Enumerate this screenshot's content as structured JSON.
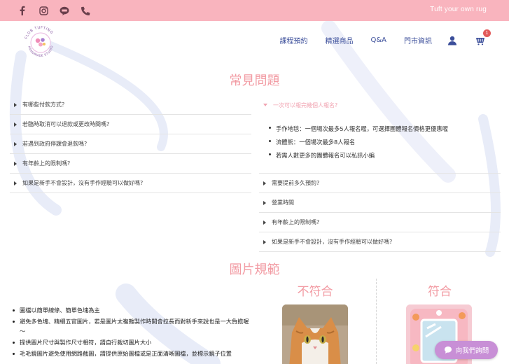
{
  "topbar": {
    "tagline": "Tuft your own rug",
    "social_icons": [
      "facebook-icon",
      "instagram-icon",
      "line-icon",
      "phone-icon"
    ]
  },
  "logo": {
    "text_top": "FLOB TUFTING",
    "text_bottom": "HANDMADE STUDIO"
  },
  "nav": {
    "items": [
      "課程預約",
      "精選商品",
      "Q&A",
      "門市資訊"
    ],
    "cart_count": "1"
  },
  "faq": {
    "title": "常見問題",
    "left_items": [
      "有哪些付款方式？",
      "若臨時取消可以退款或更改時間嗎?",
      "若遇到政府停課會退款嗎?",
      "有年齡上的限制嗎?",
      "如果是新手不會設計，沒有手作經驗可以做好嗎?"
    ],
    "right_open": {
      "question": "一次可以報完幾個人報名?",
      "answers": [
        "手作地毯：一個場次最多5人報名喔，可選擇團體報名價格更優惠喔",
        "流體熊：一個場次最多8人報名",
        "若需人數更多的團體報名可以私訊小編"
      ]
    },
    "right_items": [
      "需要提前多久預約?",
      "營業時間",
      "有年齡上的限制嗎?",
      "如果是新手不會設計，沒有手作經驗可以做好嗎?"
    ]
  },
  "image_spec": {
    "title": "圖片規範",
    "rules": [
      "圖檔以簡單線條、簡單色塊為主",
      "避免多色塊、精細五官圖片，若是圖片太複雜製作時間會拉長而對新手來說也是一大負擔喔～",
      "提供圖片尺寸與製作尺寸相符，請自行裁切圖片大小",
      "毛毛鏡圖片避免使用網路截圖，請提供原始圖檔或是正面清晰圖檔，並標示鏡子位置"
    ],
    "bad_label": "不符合",
    "good_label": "符合"
  },
  "chat": {
    "label": "向我們詢問"
  },
  "colors": {
    "topbar": "#f9b4be",
    "nav_text": "#3b4e9a",
    "accent_pink": "#f29ba3",
    "chat_button": "#c88fd6"
  }
}
